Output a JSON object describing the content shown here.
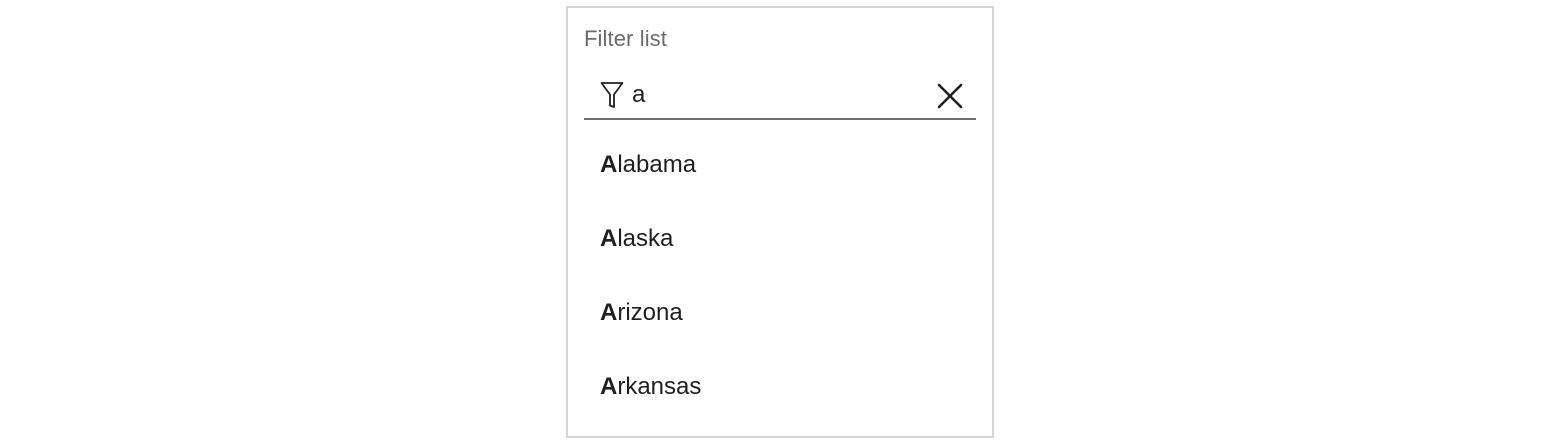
{
  "filter": {
    "label": "Filter list",
    "input_value": "a",
    "icon": "filter-icon",
    "clear_icon": "close-icon"
  },
  "results": [
    {
      "match": "A",
      "rest": "labama"
    },
    {
      "match": "A",
      "rest": "laska"
    },
    {
      "match": "A",
      "rest": "rizona"
    },
    {
      "match": "A",
      "rest": "rkansas"
    }
  ],
  "colors": {
    "border": "#d4d4d4",
    "label": "#6b6b6b",
    "underline": "#6e6e6e",
    "text": "#1f1f1f"
  }
}
